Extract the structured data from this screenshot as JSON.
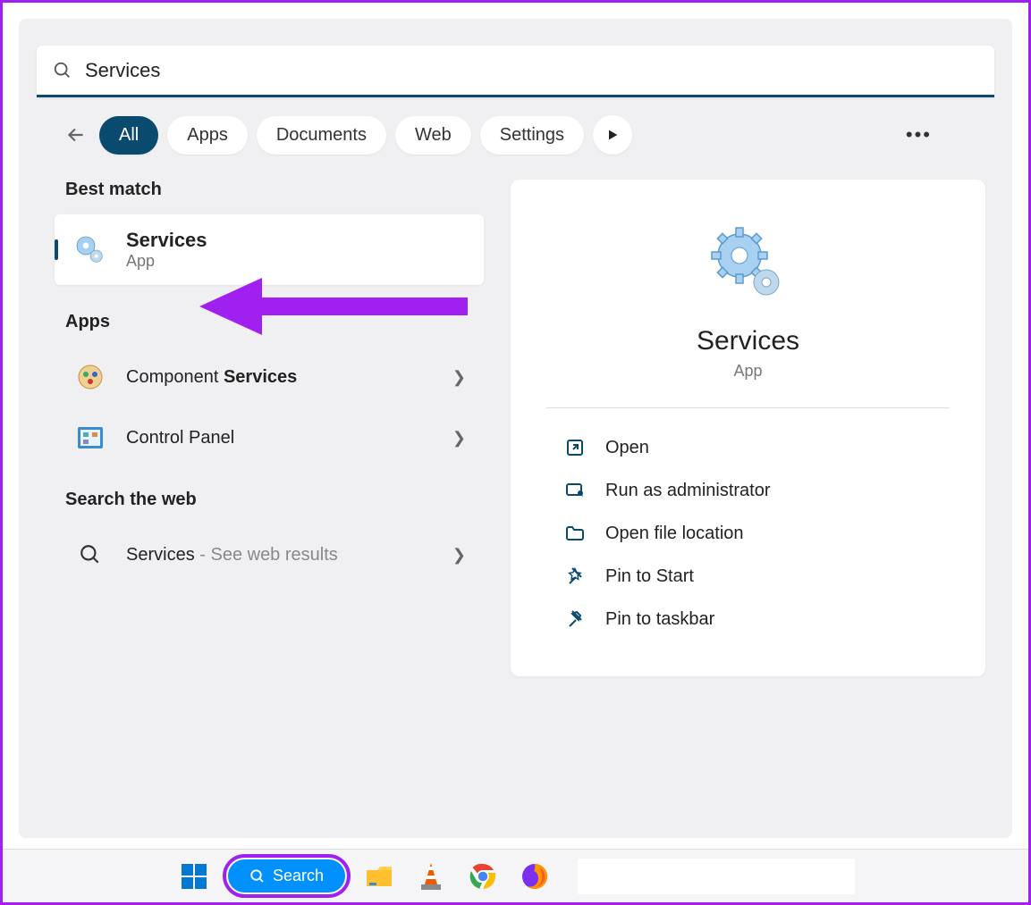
{
  "search": {
    "value": "Services"
  },
  "tabs": {
    "all": "All",
    "apps": "Apps",
    "documents": "Documents",
    "web": "Web",
    "settings": "Settings"
  },
  "sections": {
    "best_match": "Best match",
    "apps": "Apps",
    "search_web": "Search the web"
  },
  "best_match": {
    "name": "Services",
    "sub": "App"
  },
  "apps_list": [
    {
      "prefix": "Component ",
      "bold": "Services"
    },
    {
      "prefix": "Control Panel",
      "bold": ""
    }
  ],
  "web_search": {
    "term": "Services",
    "suffix": " - See web results"
  },
  "detail": {
    "title": "Services",
    "subtitle": "App"
  },
  "actions": {
    "open": "Open",
    "admin": "Run as administrator",
    "file_loc": "Open file location",
    "pin_start": "Pin to Start",
    "pin_taskbar": "Pin to taskbar"
  },
  "taskbar": {
    "search_label": "Search"
  }
}
